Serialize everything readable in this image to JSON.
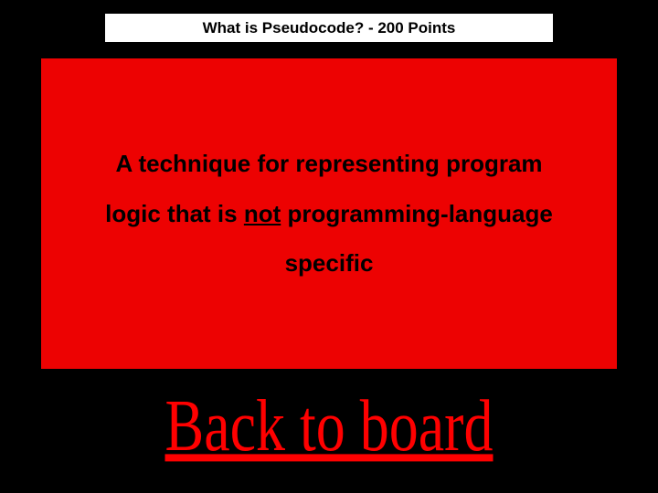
{
  "title": "What is Pseudocode? - 200 Points",
  "answer": {
    "line1_pre": "A technique for representing program logic that is ",
    "line1_underlined": "not",
    "line2": " programming-language specific"
  },
  "back_label": "Back to board"
}
